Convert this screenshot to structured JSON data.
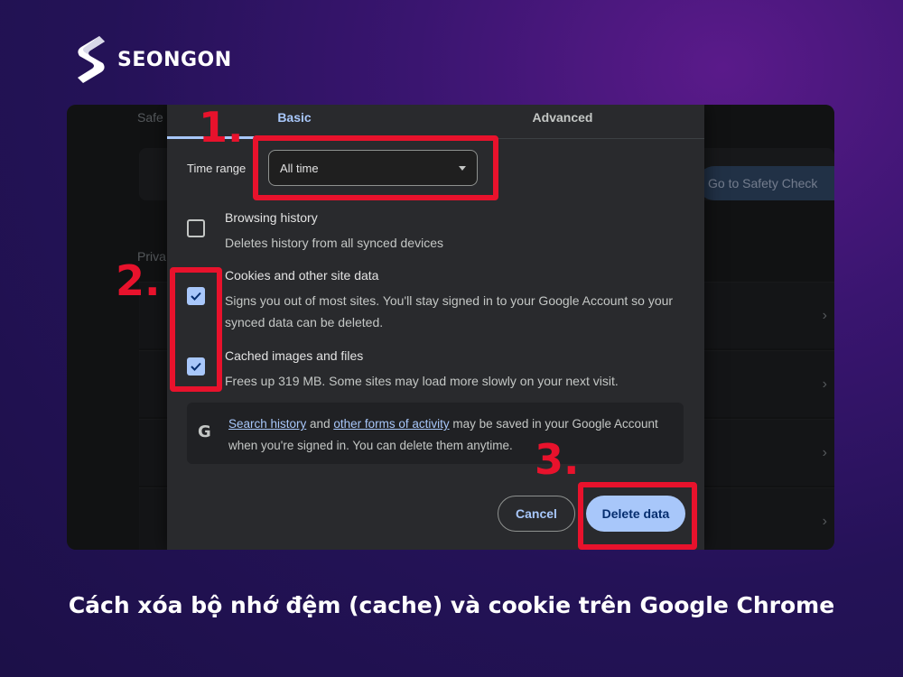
{
  "brand": {
    "name": "SEONGON",
    "logo_icon": "seongon-s-logo-icon"
  },
  "background_page": {
    "heading_fragment": "Safe",
    "privacy_fragment": "Priva",
    "safety_check_button": "Go to Safety Check"
  },
  "dialog": {
    "tabs": [
      {
        "label": "Basic",
        "selected": true
      },
      {
        "label": "Advanced",
        "selected": false
      }
    ],
    "time_range": {
      "label": "Time range",
      "value": "All time"
    },
    "options": [
      {
        "title": "Browsing history",
        "description": "Deletes history from all synced devices",
        "checked": false
      },
      {
        "title": "Cookies and other site data",
        "description": "Signs you out of most sites. You'll stay signed in to your Google Account so your synced data can be deleted.",
        "checked": true
      },
      {
        "title": "Cached images and files",
        "description": "Frees up 319 MB. Some sites may load more slowly on your next visit.",
        "checked": true
      }
    ],
    "google_note": {
      "icon": "google-g-icon",
      "link1": "Search history",
      "text1": " and ",
      "link2": "other forms of activity",
      "text2": " may be saved in your Google Account when you're signed in. You can delete them anytime."
    },
    "buttons": {
      "cancel": "Cancel",
      "delete": "Delete data"
    }
  },
  "annotations": {
    "step1": "1.",
    "step2": "2.",
    "step3": "3.",
    "highlight_color": "#e8122c"
  },
  "caption": "Cách xóa bộ nhớ đệm (cache) và cookie trên Google Chrome",
  "colors": {
    "accent": "#a8c7fa",
    "dialog_bg": "#292a2d",
    "primary_button_text": "#062e6f"
  }
}
